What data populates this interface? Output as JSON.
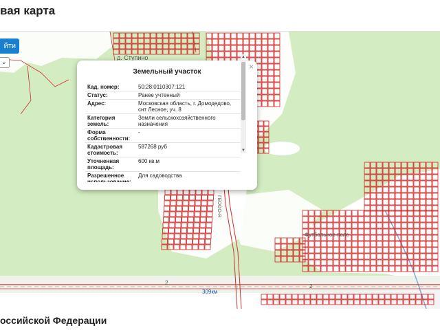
{
  "header": {
    "title": "вая карта"
  },
  "map": {
    "find_button_label": "йти",
    "village_label": "д. Ступино",
    "stadium_label": "Футбольное поле",
    "station_label": "309км",
    "road_number_left": "2",
    "road_number_right": "2",
    "railway_label": "ГЕООО-Я",
    "parcel_color": "#d21d1d",
    "forest_color": "#d4ecc2"
  },
  "popup": {
    "title": "Земельный участок",
    "close_symbol": "×",
    "rows": [
      {
        "key": "Кад. номер:",
        "value": "50:28:0110307:121"
      },
      {
        "key": "Статус:",
        "value": "Ранее учтенный"
      },
      {
        "key": "Адрес:",
        "value": "Московская область, г. Домодедово, снт Лесное, уч. 8"
      },
      {
        "key": "Категория земель:",
        "value": "Земли сельскохозяйственного назначения"
      },
      {
        "key": "Форма собственности:",
        "value": "-"
      },
      {
        "key": "Кадастровая стоимость:",
        "value": "587268 руб"
      },
      {
        "key": "Уточненная площадь:",
        "value": "600 кв.м"
      },
      {
        "key": "Разрешенное использование:",
        "value": "Для садоводства"
      }
    ]
  },
  "footer": {
    "section_title": "оссийской Федерации"
  }
}
